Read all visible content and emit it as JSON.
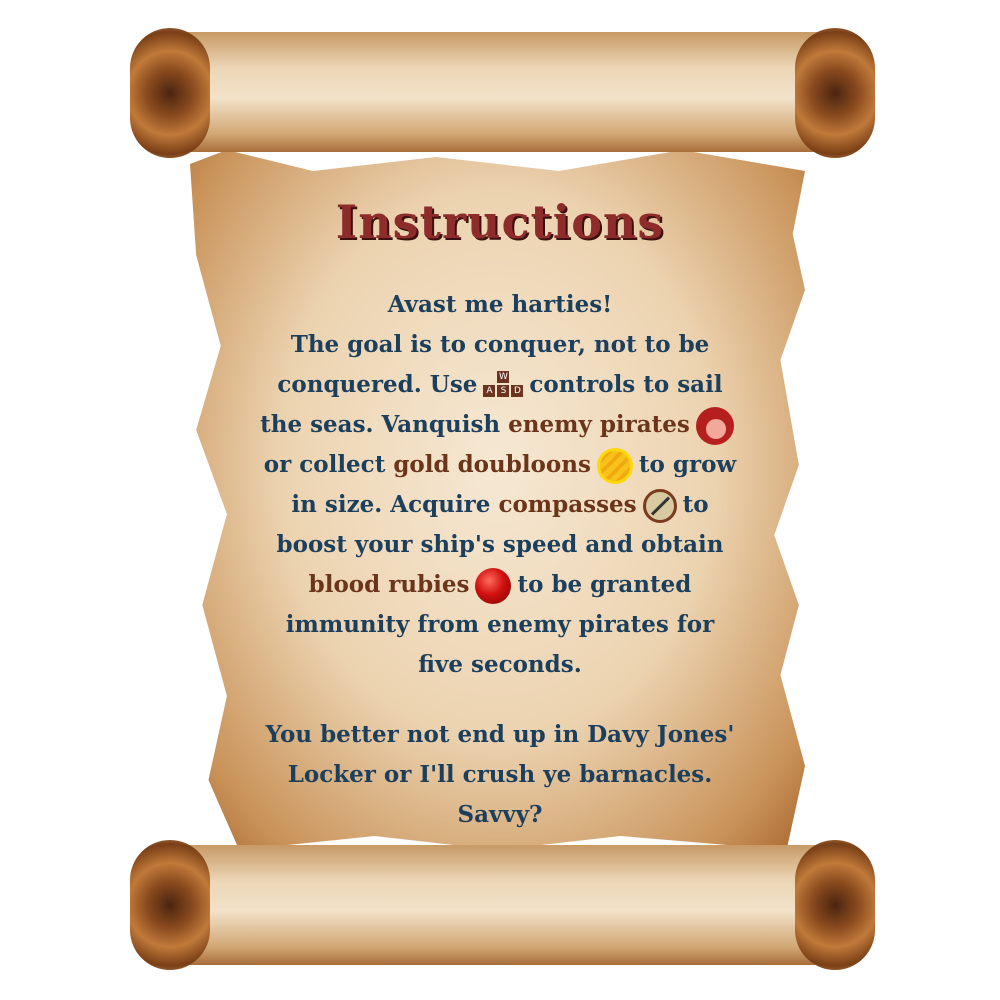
{
  "title": "Instructions",
  "colors": {
    "text": "#1c3f5e",
    "highlight": "#6b351b",
    "title": "#8e2b2b"
  },
  "icons": {
    "controls": "wasd-keys-icon",
    "pirate": "enemy-pirate-icon",
    "coin": "gold-doubloon-icon",
    "compass": "compass-icon",
    "ruby": "blood-ruby-icon"
  },
  "keys": [
    "W",
    "A",
    "S",
    "D"
  ],
  "lines": [
    "Avast me harties!",
    "The goal is to conquer, not to be",
    {
      "a": "conquered. Use",
      "b": "controls to sail"
    },
    {
      "a": "the seas. Vanquish",
      "h": "enemy pirates"
    },
    {
      "a": "or collect",
      "h": "gold doubloons",
      "b": "to grow"
    },
    {
      "a": "in size. Acquire",
      "h": "compasses",
      "b": "to"
    },
    "boost your ship's speed and obtain",
    {
      "h": "blood rubies",
      "b": "to be granted"
    },
    "immunity from enemy pirates for",
    "five seconds.",
    "",
    "You better not end up in Davy Jones'",
    "Locker or I'll crush ye barnacles.",
    "Savvy?"
  ]
}
